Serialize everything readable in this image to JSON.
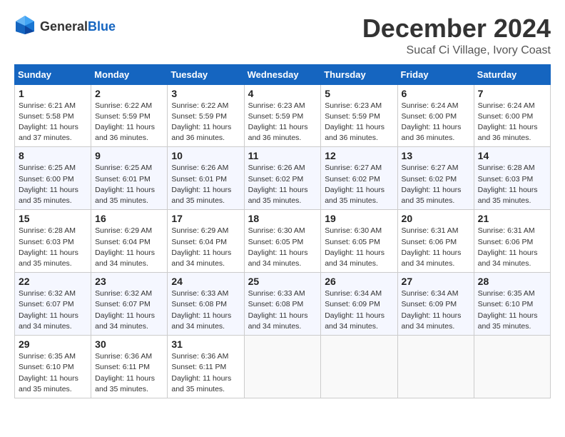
{
  "header": {
    "logo_general": "General",
    "logo_blue": "Blue",
    "month_title": "December 2024",
    "location": "Sucaf Ci Village, Ivory Coast"
  },
  "calendar": {
    "days_of_week": [
      "Sunday",
      "Monday",
      "Tuesday",
      "Wednesday",
      "Thursday",
      "Friday",
      "Saturday"
    ],
    "weeks": [
      [
        {
          "day": 1,
          "sunrise": "6:21 AM",
          "sunset": "5:58 PM",
          "daylight": "11 hours and 37 minutes"
        },
        {
          "day": 2,
          "sunrise": "6:22 AM",
          "sunset": "5:59 PM",
          "daylight": "11 hours and 36 minutes"
        },
        {
          "day": 3,
          "sunrise": "6:22 AM",
          "sunset": "5:59 PM",
          "daylight": "11 hours and 36 minutes"
        },
        {
          "day": 4,
          "sunrise": "6:23 AM",
          "sunset": "5:59 PM",
          "daylight": "11 hours and 36 minutes"
        },
        {
          "day": 5,
          "sunrise": "6:23 AM",
          "sunset": "5:59 PM",
          "daylight": "11 hours and 36 minutes"
        },
        {
          "day": 6,
          "sunrise": "6:24 AM",
          "sunset": "6:00 PM",
          "daylight": "11 hours and 36 minutes"
        },
        {
          "day": 7,
          "sunrise": "6:24 AM",
          "sunset": "6:00 PM",
          "daylight": "11 hours and 36 minutes"
        }
      ],
      [
        {
          "day": 8,
          "sunrise": "6:25 AM",
          "sunset": "6:00 PM",
          "daylight": "11 hours and 35 minutes"
        },
        {
          "day": 9,
          "sunrise": "6:25 AM",
          "sunset": "6:01 PM",
          "daylight": "11 hours and 35 minutes"
        },
        {
          "day": 10,
          "sunrise": "6:26 AM",
          "sunset": "6:01 PM",
          "daylight": "11 hours and 35 minutes"
        },
        {
          "day": 11,
          "sunrise": "6:26 AM",
          "sunset": "6:02 PM",
          "daylight": "11 hours and 35 minutes"
        },
        {
          "day": 12,
          "sunrise": "6:27 AM",
          "sunset": "6:02 PM",
          "daylight": "11 hours and 35 minutes"
        },
        {
          "day": 13,
          "sunrise": "6:27 AM",
          "sunset": "6:02 PM",
          "daylight": "11 hours and 35 minutes"
        },
        {
          "day": 14,
          "sunrise": "6:28 AM",
          "sunset": "6:03 PM",
          "daylight": "11 hours and 35 minutes"
        }
      ],
      [
        {
          "day": 15,
          "sunrise": "6:28 AM",
          "sunset": "6:03 PM",
          "daylight": "11 hours and 35 minutes"
        },
        {
          "day": 16,
          "sunrise": "6:29 AM",
          "sunset": "6:04 PM",
          "daylight": "11 hours and 34 minutes"
        },
        {
          "day": 17,
          "sunrise": "6:29 AM",
          "sunset": "6:04 PM",
          "daylight": "11 hours and 34 minutes"
        },
        {
          "day": 18,
          "sunrise": "6:30 AM",
          "sunset": "6:05 PM",
          "daylight": "11 hours and 34 minutes"
        },
        {
          "day": 19,
          "sunrise": "6:30 AM",
          "sunset": "6:05 PM",
          "daylight": "11 hours and 34 minutes"
        },
        {
          "day": 20,
          "sunrise": "6:31 AM",
          "sunset": "6:06 PM",
          "daylight": "11 hours and 34 minutes"
        },
        {
          "day": 21,
          "sunrise": "6:31 AM",
          "sunset": "6:06 PM",
          "daylight": "11 hours and 34 minutes"
        }
      ],
      [
        {
          "day": 22,
          "sunrise": "6:32 AM",
          "sunset": "6:07 PM",
          "daylight": "11 hours and 34 minutes"
        },
        {
          "day": 23,
          "sunrise": "6:32 AM",
          "sunset": "6:07 PM",
          "daylight": "11 hours and 34 minutes"
        },
        {
          "day": 24,
          "sunrise": "6:33 AM",
          "sunset": "6:08 PM",
          "daylight": "11 hours and 34 minutes"
        },
        {
          "day": 25,
          "sunrise": "6:33 AM",
          "sunset": "6:08 PM",
          "daylight": "11 hours and 34 minutes"
        },
        {
          "day": 26,
          "sunrise": "6:34 AM",
          "sunset": "6:09 PM",
          "daylight": "11 hours and 34 minutes"
        },
        {
          "day": 27,
          "sunrise": "6:34 AM",
          "sunset": "6:09 PM",
          "daylight": "11 hours and 34 minutes"
        },
        {
          "day": 28,
          "sunrise": "6:35 AM",
          "sunset": "6:10 PM",
          "daylight": "11 hours and 35 minutes"
        }
      ],
      [
        {
          "day": 29,
          "sunrise": "6:35 AM",
          "sunset": "6:10 PM",
          "daylight": "11 hours and 35 minutes"
        },
        {
          "day": 30,
          "sunrise": "6:36 AM",
          "sunset": "6:11 PM",
          "daylight": "11 hours and 35 minutes"
        },
        {
          "day": 31,
          "sunrise": "6:36 AM",
          "sunset": "6:11 PM",
          "daylight": "11 hours and 35 minutes"
        },
        null,
        null,
        null,
        null
      ]
    ]
  }
}
